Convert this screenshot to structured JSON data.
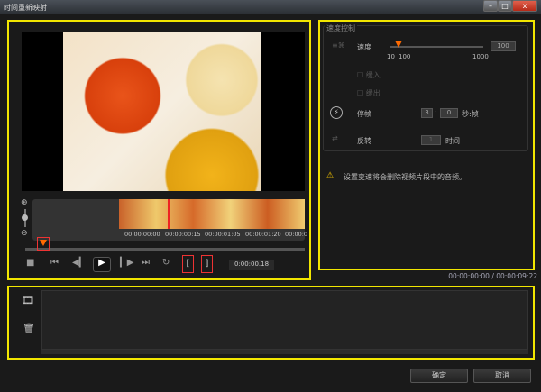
{
  "window": {
    "title": "时间重新映射",
    "minimize": "–",
    "maximize": "□",
    "close": "x"
  },
  "preview": {
    "timecodes": [
      "00:00:00:00",
      "00:00:00:15",
      "00:00:01:05",
      "00:00:01:20",
      "00:00:0"
    ],
    "current_time": "0:00:00.18"
  },
  "speed_control": {
    "group_label": "速度控制",
    "speed_label": "速度",
    "speed_min": "10",
    "speed_mark": "100",
    "speed_max": "1000",
    "speed_value": "100",
    "ease_in": "缓入",
    "ease_out": "缓出",
    "freeze_label": "停帧",
    "freeze_sec": "3",
    "freeze_frame": "0",
    "freeze_unit": "秒:帧",
    "reverse_label": "反转",
    "reverse_value": "1",
    "reverse_unit": "时间"
  },
  "warning": "设置变速将会删除视频片段中的音频。",
  "duration": "00:00:00:00 / 00:00:09:22",
  "buttons": {
    "ok": "确定",
    "cancel": "取消"
  },
  "colors": {
    "highlight": "#f2e600",
    "accent": "#ff6a00",
    "marker": "#e33333"
  }
}
